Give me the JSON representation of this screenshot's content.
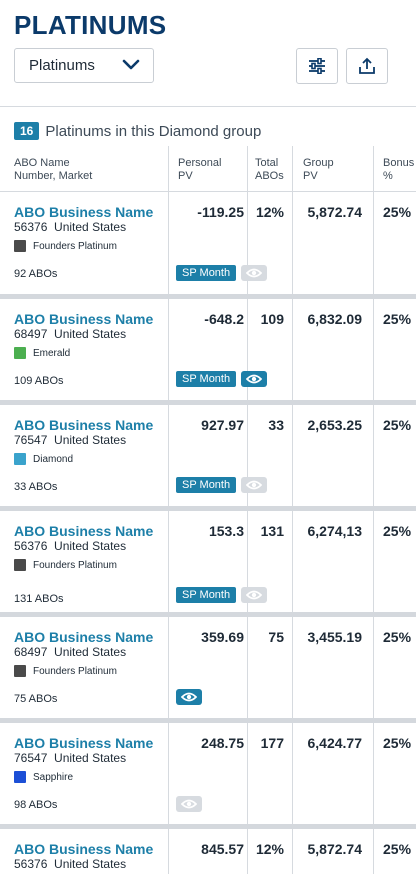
{
  "header": {
    "title": "PLATINUMS",
    "dropdown_value": "Platinums"
  },
  "summary": {
    "count": "16",
    "text": "Platinums in this Diamond group"
  },
  "columns": {
    "name_line1": "ABO Name",
    "name_line2": "Number, Market",
    "ppv_line1": "Personal",
    "ppv_line2": "PV",
    "abos_line1": "Total",
    "abos_line2": "ABOs",
    "gpv_line1": "Group",
    "gpv_line2": "PV",
    "bonus_line1": "Bonus",
    "bonus_line2": "%"
  },
  "rows": [
    {
      "name": "ABO Business Name",
      "number": "56376",
      "market": "United States",
      "rank": "Founders Platinum",
      "rank_color": "#4a4a4a",
      "abos": "92 ABOs",
      "personal_pv": "-119.25",
      "total_abos": "12%",
      "group_pv": "5,872.74",
      "bonus": "25%",
      "sp": "SP Month",
      "eye": "off"
    },
    {
      "name": "ABO Business Name",
      "number": "68497",
      "market": "United States",
      "rank": "Emerald",
      "rank_color": "#4caf50",
      "abos": "109 ABOs",
      "personal_pv": "-648.2",
      "total_abos": "109",
      "group_pv": "6,832.09",
      "bonus": "25%",
      "sp": "SP Month",
      "eye": "on"
    },
    {
      "name": "ABO Business Name",
      "number": "76547",
      "market": "United States",
      "rank": "Diamond",
      "rank_color": "#3aa3cc",
      "abos": "33 ABOs",
      "personal_pv": "927.97",
      "total_abos": "33",
      "group_pv": "2,653.25",
      "bonus": "25%",
      "sp": "SP Month",
      "eye": "off"
    },
    {
      "name": "ABO Business Name",
      "number": "56376",
      "market": "United States",
      "rank": "Founders Platinum",
      "rank_color": "#4a4a4a",
      "abos": "131 ABOs",
      "personal_pv": "153.3",
      "total_abos": "131",
      "group_pv": "6,274,13",
      "bonus": "25%",
      "sp": "SP Month",
      "eye": "off"
    },
    {
      "name": "ABO Business Name",
      "number": "68497",
      "market": "United States",
      "rank": "Founders Platinum",
      "rank_color": "#4a4a4a",
      "abos": "75 ABOs",
      "personal_pv": "359.69",
      "total_abos": "75",
      "group_pv": "3,455.19",
      "bonus": "25%",
      "sp": "",
      "eye": "on"
    },
    {
      "name": "ABO Business Name",
      "number": "76547",
      "market": "United States",
      "rank": "Sapphire",
      "rank_color": "#1c4fd6",
      "abos": "98 ABOs",
      "personal_pv": "248.75",
      "total_abos": "177",
      "group_pv": "6,424.77",
      "bonus": "25%",
      "sp": "",
      "eye": "off"
    },
    {
      "name": "ABO Business Name",
      "number": "56376",
      "market": "United States",
      "rank": "",
      "rank_color": "",
      "abos": "",
      "personal_pv": "845.57",
      "total_abos": "12%",
      "group_pv": "5,872.74",
      "bonus": "25%",
      "sp": "",
      "eye": ""
    }
  ],
  "icons": {
    "dropdown": "chevron-down-icon",
    "filter": "sliders-icon",
    "share": "share-upload-icon",
    "eye": "eye-icon"
  },
  "colors": {
    "title": "#0b3a6a",
    "accent": "#1d7fa8",
    "eye_off": "#d7dbe0"
  }
}
